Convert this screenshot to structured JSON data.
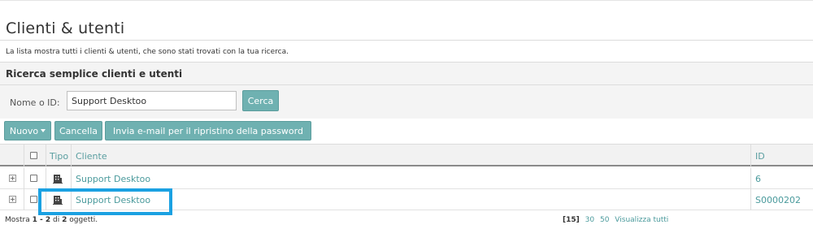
{
  "page": {
    "title": "Clienti & utenti",
    "description": "La lista mostra tutti i clienti & utenti, che sono stati trovati con la tua ricerca."
  },
  "search": {
    "heading": "Ricerca semplice clienti e utenti",
    "label": "Nome o ID:",
    "value": "Support Desktoo",
    "button": "Cerca"
  },
  "toolbar": {
    "new_label": "Nuovo",
    "cancel_label": "Cancella",
    "reset_label": "Invia e-mail per il ripristino della password"
  },
  "table": {
    "headers": {
      "type": "Tipo",
      "client": "Cliente",
      "id": "ID"
    },
    "rows": [
      {
        "expand": "+",
        "type_icon": "building-icon",
        "client": "Support Desktoo",
        "id": "6"
      },
      {
        "expand": "+",
        "type_icon": "building-icon",
        "client": "Support Desktoo",
        "id": "S0000202"
      }
    ]
  },
  "footer": {
    "prefix": "Mostra",
    "range": "1 - 2",
    "of": "di",
    "total": "2",
    "suffix": "oggetti.",
    "page_size_current": "[15]",
    "page_size_30": "30",
    "page_size_50": "50",
    "show_all": "Visualizza tutti"
  },
  "colors": {
    "accent": "#6fb1b1",
    "link": "#4a9a9c",
    "highlight": "#1ba1e2"
  }
}
